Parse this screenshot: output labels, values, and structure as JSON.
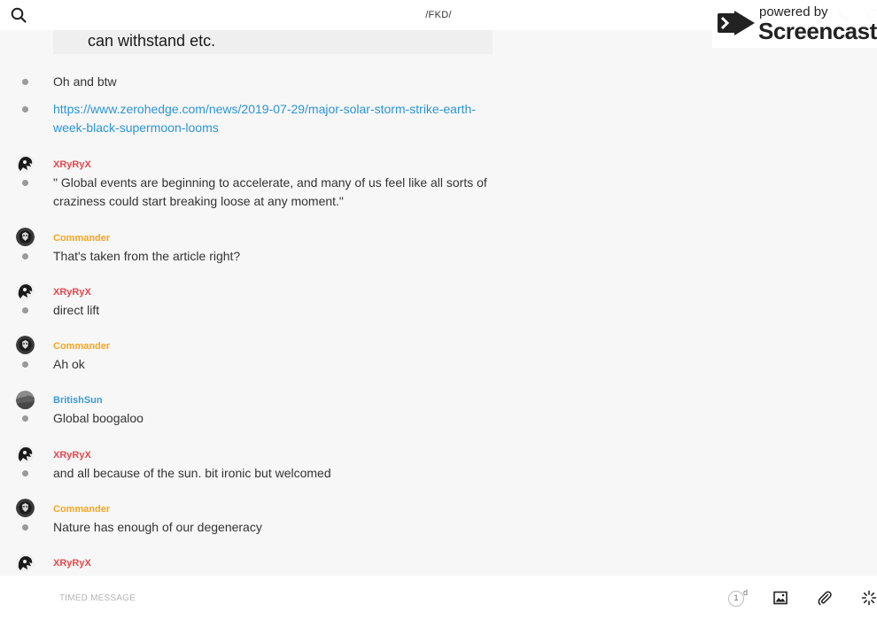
{
  "header": {
    "channel_title": "/FKD/"
  },
  "watermark": {
    "powered_by": "powered by",
    "brand": "Screencastify"
  },
  "quoted_text": "can withstand etc.",
  "colors": {
    "XRyRyX": "#e5484d",
    "Commander": "#f5a623",
    "BritishSun": "#3d9ad1",
    "link": "#2b95d6"
  },
  "messages": [
    {
      "kind": "text",
      "text": "Oh and btw"
    },
    {
      "kind": "link",
      "text": "https://www.zerohedge.com/news/2019-07-29/major-solar-storm-strike-earth-week-black-supermoon-looms"
    },
    {
      "kind": "user",
      "user": "XRyRyX",
      "avatar": "xryryx-avatar",
      "text": "\" Global events are beginning to accelerate, and many of us feel like all sorts of craziness could start breaking loose at any moment.\""
    },
    {
      "kind": "user",
      "user": "Commander",
      "avatar": "commander-avatar",
      "text": "That's taken from the article right?"
    },
    {
      "kind": "user",
      "user": "XRyRyX",
      "avatar": "xryryx-avatar",
      "text": "direct lift"
    },
    {
      "kind": "user",
      "user": "Commander",
      "avatar": "commander-avatar",
      "text": "Ah ok"
    },
    {
      "kind": "user",
      "user": "BritishSun",
      "avatar": "britishsun-avatar",
      "text": "Global boogaloo"
    },
    {
      "kind": "user",
      "user": "XRyRyX",
      "avatar": "xryryx-avatar",
      "text": "and all because of the sun. bit ironic but welcomed"
    },
    {
      "kind": "user",
      "user": "Commander",
      "avatar": "commander-avatar",
      "text": "Nature has enough of our degeneracy"
    },
    {
      "kind": "user",
      "user": "XRyRyX",
      "avatar": "xryryx-avatar",
      "text": ""
    }
  ],
  "composer": {
    "placeholder": "TIMED MESSAGE",
    "timer_value": "1",
    "timer_unit": "d"
  },
  "icons": {
    "search": "search-icon",
    "phone": "phone-icon",
    "info": "info-icon",
    "image": "image-icon",
    "attach": "paperclip-icon",
    "loader": "loader-icon"
  }
}
